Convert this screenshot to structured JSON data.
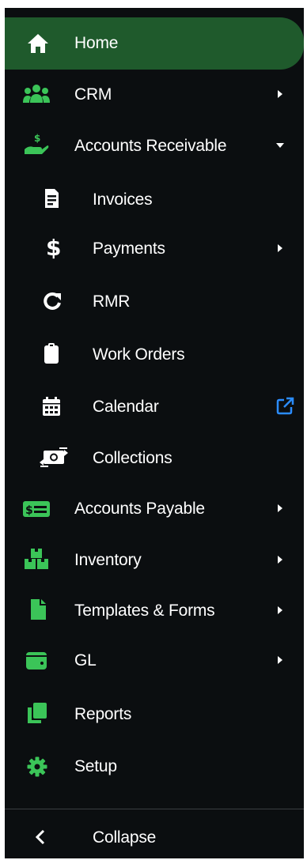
{
  "sidebar": {
    "items": [
      {
        "label": "Home",
        "icon": "home-icon",
        "active": true
      },
      {
        "label": "CRM",
        "icon": "users-icon",
        "has_submenu": true
      },
      {
        "label": "Accounts Receivable",
        "icon": "hand-dollar-icon",
        "has_submenu": true,
        "expanded": true
      },
      {
        "label": "Invoices",
        "icon": "invoice-icon",
        "sub": true
      },
      {
        "label": "Payments",
        "icon": "dollar-icon",
        "sub": true,
        "has_submenu": true
      },
      {
        "label": "RMR",
        "icon": "refresh-icon",
        "sub": true
      },
      {
        "label": "Work Orders",
        "icon": "clipboard-icon",
        "sub": true
      },
      {
        "label": "Calendar",
        "icon": "calendar-icon",
        "sub": true,
        "external": true
      },
      {
        "label": "Collections",
        "icon": "money-exchange-icon",
        "sub": true
      },
      {
        "label": "Accounts Payable",
        "icon": "money-bill-icon",
        "has_submenu": true
      },
      {
        "label": "Inventory",
        "icon": "boxes-icon",
        "has_submenu": true
      },
      {
        "label": "Templates & Forms",
        "icon": "file-icon",
        "has_submenu": true
      },
      {
        "label": "GL",
        "icon": "wallet-icon",
        "has_submenu": true
      },
      {
        "label": "Reports",
        "icon": "copy-icon"
      },
      {
        "label": "Setup",
        "icon": "gear-icon"
      }
    ],
    "collapse_label": "Collapse"
  },
  "colors": {
    "background": "#0b0e10",
    "active": "#1f5a2c",
    "accent": "#3bc458",
    "external_link": "#2b8cff"
  }
}
